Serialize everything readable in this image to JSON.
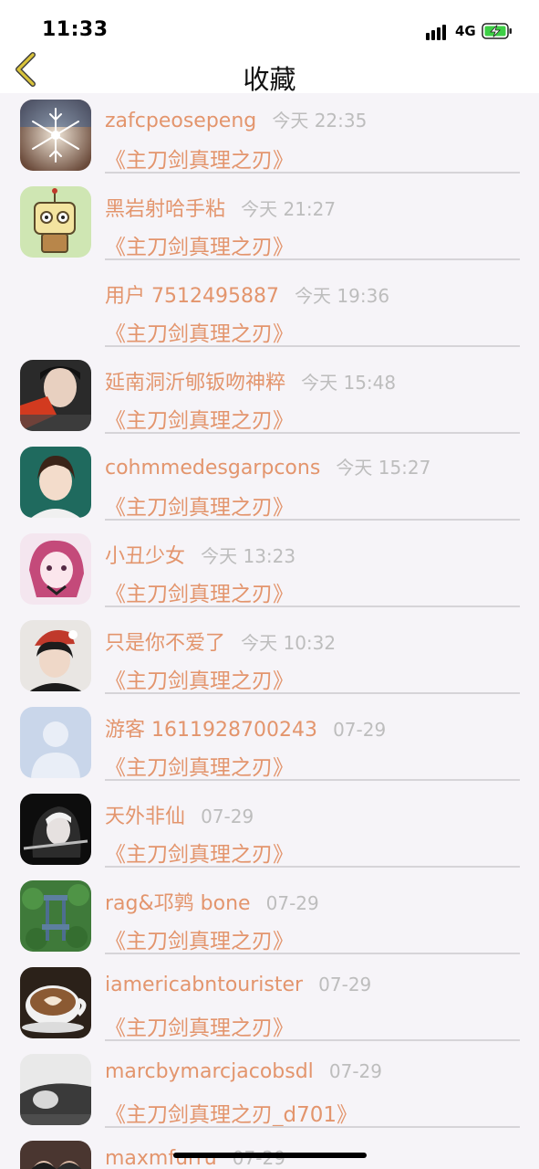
{
  "status_bar": {
    "time": "11:33",
    "network": "4G",
    "battery_charging": true
  },
  "header": {
    "title": "收藏",
    "back_icon": "chevron-left-icon",
    "accent_color": "#d9c33b"
  },
  "colors": {
    "name": "#e3956d",
    "time": "#bdbdbd",
    "background": "#f6f4f8"
  },
  "favorites": [
    {
      "user": "zafcpeosepeng",
      "time": "今天 22:35",
      "title": "《主刀剑真理之刃》",
      "avatar": "snowflake"
    },
    {
      "user": "黑岩射哈手粘",
      "time": "今天 21:27",
      "title": "《主刀剑真理之刃》",
      "avatar": "cartoon-robot"
    },
    {
      "user": "用户 7512495887",
      "time": "今天 19:36",
      "title": "《主刀剑真理之刃》",
      "avatar": "none"
    },
    {
      "user": "延南洞沂郇钣吻神粹",
      "time": "今天 15:48",
      "title": "《主刀剑真理之刃》",
      "avatar": "photo-person"
    },
    {
      "user": "cohmmedesgarpcons",
      "time": "今天 15:27",
      "title": "《主刀剑真理之刃》",
      "avatar": "photo-child"
    },
    {
      "user": "小丑少女",
      "time": "今天 13:23",
      "title": "《主刀剑真理之刃》",
      "avatar": "anime-girl"
    },
    {
      "user": "只是你不爱了",
      "time": "今天 10:32",
      "title": "《主刀剑真理之刃》",
      "avatar": "photo-santa-hat"
    },
    {
      "user": "游客 1611928700243",
      "time": "07-29",
      "title": "《主刀剑真理之刃》",
      "avatar": "default-user"
    },
    {
      "user": "天外非仙",
      "time": "07-29",
      "title": "《主刀剑真理之刃》",
      "avatar": "anime-dark"
    },
    {
      "user": "rag&邛鹑 bone",
      "time": "07-29",
      "title": "《主刀剑真理之刃》",
      "avatar": "photo-chair"
    },
    {
      "user": "iamericabntourister",
      "time": "07-29",
      "title": "《主刀剑真理之刃》",
      "avatar": "coffee-cup"
    },
    {
      "user": "marcbymarcjacobsdl",
      "time": "07-29",
      "title": "《主刀剑真理之刃_d701》",
      "avatar": "photo-mono"
    },
    {
      "user": "maxmfurru",
      "time": "07-29",
      "title": "",
      "avatar": "photo-couple"
    }
  ]
}
